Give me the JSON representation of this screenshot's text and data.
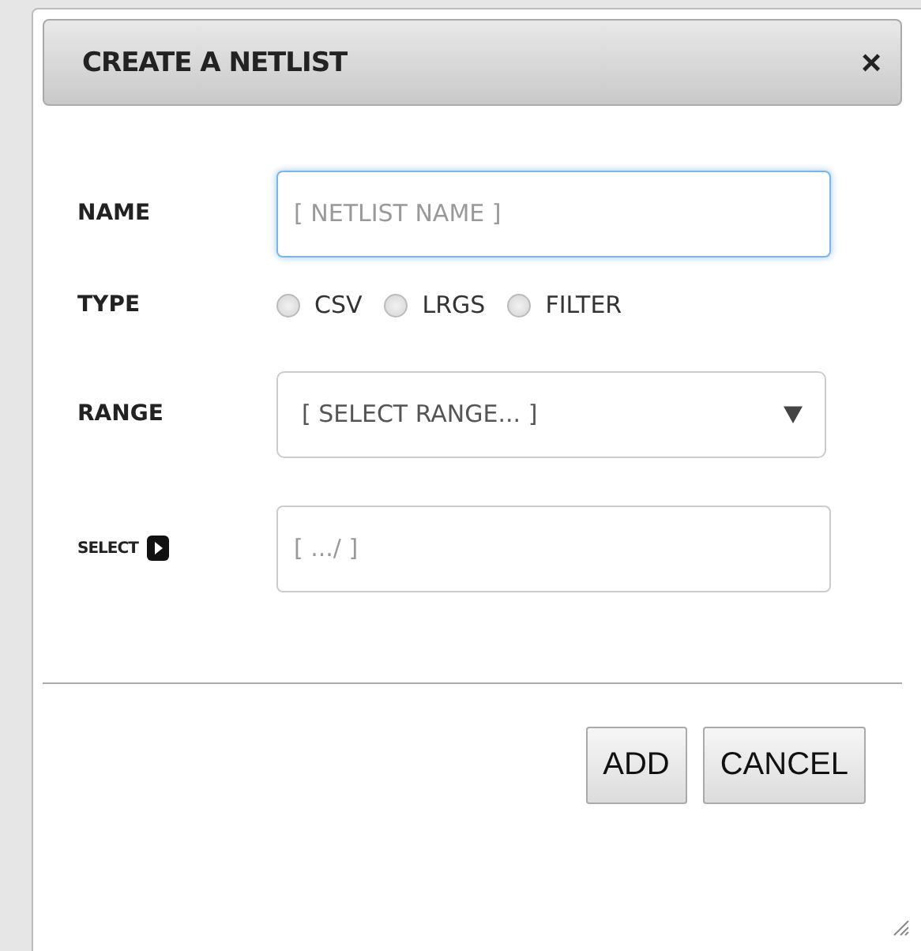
{
  "dialog": {
    "title": "CREATE A NETLIST",
    "close": "×"
  },
  "fields": [
    {
      "kind": "text",
      "label": "NAME",
      "placeholder": "[ NETLIST NAME ]",
      "focused": true
    },
    {
      "kind": "radio",
      "label": "TYPE",
      "options": [
        {
          "label": "CSV",
          "selected": false
        },
        {
          "label": "LRGS",
          "selected": false
        },
        {
          "label": "FILTER",
          "selected": false
        }
      ]
    },
    {
      "kind": "select",
      "label": "RANGE",
      "value": "[ SELECT RANGE... ]"
    },
    {
      "kind": "path",
      "label": "SELECT",
      "placeholder": "[ .../ ]",
      "focused": false
    }
  ],
  "buttons": [
    "ADD",
    "CANCEL"
  ]
}
